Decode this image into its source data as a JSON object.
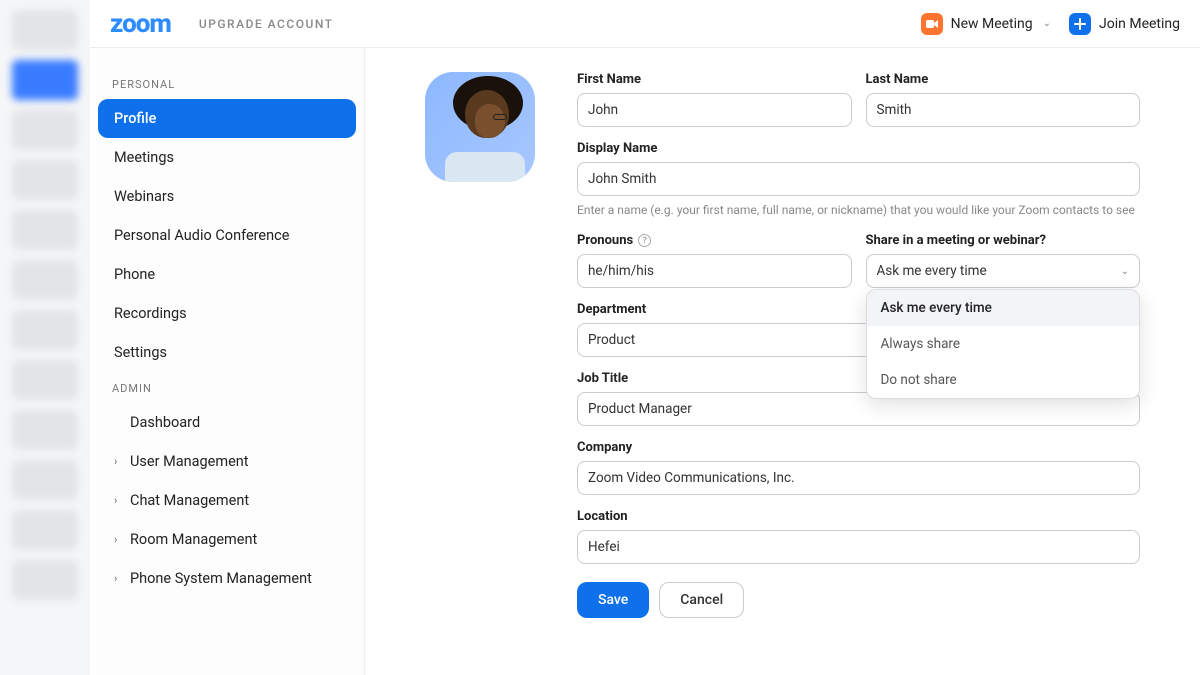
{
  "header": {
    "logo_text": "zoom",
    "upgrade": "UPGRADE ACCOUNT",
    "new_meeting": "New Meeting",
    "join_meeting": "Join Meeting"
  },
  "sidebar": {
    "sections": {
      "personal": "PERSONAL",
      "admin": "ADMIN"
    },
    "personal_items": [
      {
        "label": "Profile",
        "active": true
      },
      {
        "label": "Meetings"
      },
      {
        "label": "Webinars"
      },
      {
        "label": "Personal Audio Conference"
      },
      {
        "label": "Phone"
      },
      {
        "label": "Recordings"
      },
      {
        "label": "Settings"
      }
    ],
    "admin_items": [
      {
        "label": "Dashboard",
        "expandable": false
      },
      {
        "label": "User Management",
        "expandable": true
      },
      {
        "label": "Chat Management",
        "expandable": true
      },
      {
        "label": "Room Management",
        "expandable": true
      },
      {
        "label": "Phone System Management",
        "expandable": true
      }
    ]
  },
  "form": {
    "first_name": {
      "label": "First Name",
      "value": "John"
    },
    "last_name": {
      "label": "Last Name",
      "value": "Smith"
    },
    "display_name": {
      "label": "Display Name",
      "value": "John Smith",
      "hint": "Enter a name (e.g. your first name, full name, or nickname) that you would like your Zoom contacts to see"
    },
    "pronouns": {
      "label": "Pronouns",
      "value": "he/him/his"
    },
    "share": {
      "label": "Share in a meeting or webinar?",
      "selected": "Ask me every time",
      "options": [
        "Ask me every time",
        "Always share",
        "Do not share"
      ]
    },
    "department": {
      "label": "Department",
      "value": "Product"
    },
    "job_title": {
      "label": "Job Title",
      "value": "Product Manager"
    },
    "company": {
      "label": "Company",
      "value": "Zoom Video Communications, Inc."
    },
    "location": {
      "label": "Location",
      "value": "Hefei"
    },
    "save": "Save",
    "cancel": "Cancel"
  }
}
